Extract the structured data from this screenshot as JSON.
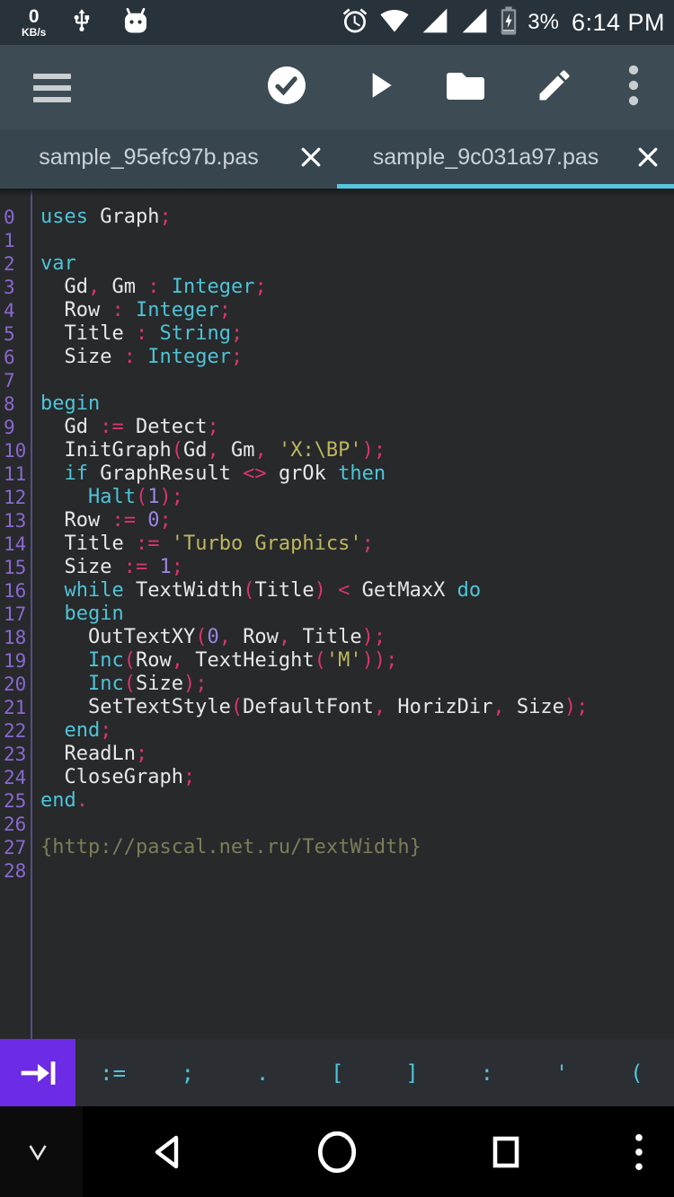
{
  "colors": {
    "status_bar_bg": "#28323a",
    "toolbar_bg": "#3d4b54",
    "tab_bar_bg": "#37454f",
    "tab_active_underline": "#54c6dd",
    "editor_bg": "#27292b",
    "gutter_number": "#8a68d0",
    "keyword_cyan": "#4fc3d7",
    "punctuation_pink": "#d9356b",
    "number_purple": "#9c85e0",
    "string_yellow": "#bfb75e",
    "comment_olive": "#7d7d58",
    "symbol_key_cyan": "#4fc4dc",
    "tab_key_purple": "#6c2be4"
  },
  "status_bar": {
    "net_speed_value": "0",
    "net_speed_unit": "KB/s",
    "battery_percent": "3%",
    "time": "6:14 PM",
    "left_icons": [
      "usb-icon",
      "android-icon"
    ],
    "right_icons": [
      "alarm-icon",
      "wifi-icon",
      "signal-icon",
      "signal-icon",
      "battery-charging-icon"
    ]
  },
  "toolbar": {
    "icons": [
      "menu-icon",
      "check-circle-icon",
      "play-icon",
      "folder-icon",
      "edit-icon",
      "overflow-icon"
    ]
  },
  "tabs": [
    {
      "label": "sample_95efc97b.pas",
      "active": false
    },
    {
      "label": "sample_9c031a97.pas",
      "active": true
    }
  ],
  "editor": {
    "lines": [
      {
        "n": "0",
        "t": [
          [
            "uses",
            "k"
          ],
          [
            " Graph",
            "i"
          ],
          [
            ";",
            "p"
          ]
        ]
      },
      {
        "n": "1",
        "t": []
      },
      {
        "n": "2",
        "t": [
          [
            "var",
            "k"
          ]
        ]
      },
      {
        "n": "3",
        "t": [
          [
            "  Gd",
            "i"
          ],
          [
            ", ",
            "p"
          ],
          [
            "Gm ",
            "i"
          ],
          [
            ": ",
            "p"
          ],
          [
            "Integer",
            "k"
          ],
          [
            ";",
            "p"
          ]
        ]
      },
      {
        "n": "4",
        "t": [
          [
            "  Row ",
            "i"
          ],
          [
            ": ",
            "p"
          ],
          [
            "Integer",
            "k"
          ],
          [
            ";",
            "p"
          ]
        ]
      },
      {
        "n": "5",
        "t": [
          [
            "  Title ",
            "i"
          ],
          [
            ": ",
            "p"
          ],
          [
            "String",
            "k"
          ],
          [
            ";",
            "p"
          ]
        ]
      },
      {
        "n": "6",
        "t": [
          [
            "  Size ",
            "i"
          ],
          [
            ": ",
            "p"
          ],
          [
            "Integer",
            "k"
          ],
          [
            ";",
            "p"
          ]
        ]
      },
      {
        "n": "7",
        "t": []
      },
      {
        "n": "8",
        "t": [
          [
            "begin",
            "k"
          ]
        ]
      },
      {
        "n": "9",
        "t": [
          [
            "  Gd ",
            "i"
          ],
          [
            ":= ",
            "p"
          ],
          [
            "Detect",
            "i"
          ],
          [
            ";",
            "p"
          ]
        ]
      },
      {
        "n": "10",
        "t": [
          [
            "  InitGraph",
            "i"
          ],
          [
            "(",
            "p"
          ],
          [
            "Gd",
            "i"
          ],
          [
            ", ",
            "p"
          ],
          [
            "Gm",
            "i"
          ],
          [
            ", ",
            "p"
          ],
          [
            "'X:\\BP'",
            "s"
          ],
          [
            ")",
            "p"
          ],
          [
            ";",
            "p"
          ]
        ]
      },
      {
        "n": "11",
        "t": [
          [
            "  if ",
            "k"
          ],
          [
            "GraphResult ",
            "i"
          ],
          [
            "<> ",
            "p"
          ],
          [
            "grOk ",
            "i"
          ],
          [
            "then",
            "k"
          ]
        ]
      },
      {
        "n": "12",
        "t": [
          [
            "    Halt",
            "k"
          ],
          [
            "(",
            "p"
          ],
          [
            "1",
            "n"
          ],
          [
            ")",
            "p"
          ],
          [
            ";",
            "p"
          ]
        ]
      },
      {
        "n": "13",
        "t": [
          [
            "  Row ",
            "i"
          ],
          [
            ":= ",
            "p"
          ],
          [
            "0",
            "n"
          ],
          [
            ";",
            "p"
          ]
        ]
      },
      {
        "n": "14",
        "t": [
          [
            "  Title ",
            "i"
          ],
          [
            ":= ",
            "p"
          ],
          [
            "'Turbo Graphics'",
            "s"
          ],
          [
            ";",
            "p"
          ]
        ]
      },
      {
        "n": "15",
        "t": [
          [
            "  Size ",
            "i"
          ],
          [
            ":= ",
            "p"
          ],
          [
            "1",
            "n"
          ],
          [
            ";",
            "p"
          ]
        ]
      },
      {
        "n": "16",
        "t": [
          [
            "  while ",
            "k"
          ],
          [
            "TextWidth",
            "i"
          ],
          [
            "(",
            "p"
          ],
          [
            "Title",
            "i"
          ],
          [
            ")",
            "p"
          ],
          [
            " < ",
            "p"
          ],
          [
            "GetMaxX ",
            "i"
          ],
          [
            "do",
            "k"
          ]
        ]
      },
      {
        "n": "17",
        "t": [
          [
            "  begin",
            "k"
          ]
        ]
      },
      {
        "n": "18",
        "t": [
          [
            "    OutTextXY",
            "i"
          ],
          [
            "(",
            "p"
          ],
          [
            "0",
            "n"
          ],
          [
            ", ",
            "p"
          ],
          [
            "Row",
            "i"
          ],
          [
            ", ",
            "p"
          ],
          [
            "Title",
            "i"
          ],
          [
            ")",
            "p"
          ],
          [
            ";",
            "p"
          ]
        ]
      },
      {
        "n": "19",
        "t": [
          [
            "    Inc",
            "k"
          ],
          [
            "(",
            "p"
          ],
          [
            "Row",
            "i"
          ],
          [
            ", ",
            "p"
          ],
          [
            "TextHeight",
            "i"
          ],
          [
            "(",
            "p"
          ],
          [
            "'M'",
            "s"
          ],
          [
            "))",
            "p"
          ],
          [
            ";",
            "p"
          ]
        ]
      },
      {
        "n": "20",
        "t": [
          [
            "    Inc",
            "k"
          ],
          [
            "(",
            "p"
          ],
          [
            "Size",
            "i"
          ],
          [
            ")",
            "p"
          ],
          [
            ";",
            "p"
          ]
        ]
      },
      {
        "n": "21",
        "t": [
          [
            "    SetTextStyle",
            "i"
          ],
          [
            "(",
            "p"
          ],
          [
            "DefaultFont",
            "i"
          ],
          [
            ", ",
            "p"
          ],
          [
            "HorizDir",
            "i"
          ],
          [
            ", ",
            "p"
          ],
          [
            "Size",
            "i"
          ],
          [
            ")",
            "p"
          ],
          [
            ";",
            "p"
          ]
        ]
      },
      {
        "n": "22",
        "t": [
          [
            "  end",
            "k"
          ],
          [
            ";",
            "p"
          ]
        ]
      },
      {
        "n": "23",
        "t": [
          [
            "  ReadLn",
            "i"
          ],
          [
            ";",
            "p"
          ]
        ]
      },
      {
        "n": "24",
        "t": [
          [
            "  CloseGraph",
            "i"
          ],
          [
            ";",
            "p"
          ]
        ]
      },
      {
        "n": "25",
        "t": [
          [
            "end",
            "k"
          ],
          [
            ".",
            "p"
          ]
        ]
      },
      {
        "n": "26",
        "t": []
      },
      {
        "n": "27",
        "t": [
          [
            "{http://pascal.net.ru/TextWidth}",
            "c"
          ]
        ]
      },
      {
        "n": "28",
        "t": []
      }
    ]
  },
  "symbol_bar": {
    "tab_key_icon": "tab-right-icon",
    "keys": [
      ":=",
      ";",
      ".",
      "[",
      "]",
      ":",
      "'",
      "("
    ]
  },
  "nav_bar": {
    "icons": [
      "hide-keyboard-icon",
      "back-icon",
      "home-icon",
      "recents-icon",
      "overflow-icon"
    ]
  }
}
